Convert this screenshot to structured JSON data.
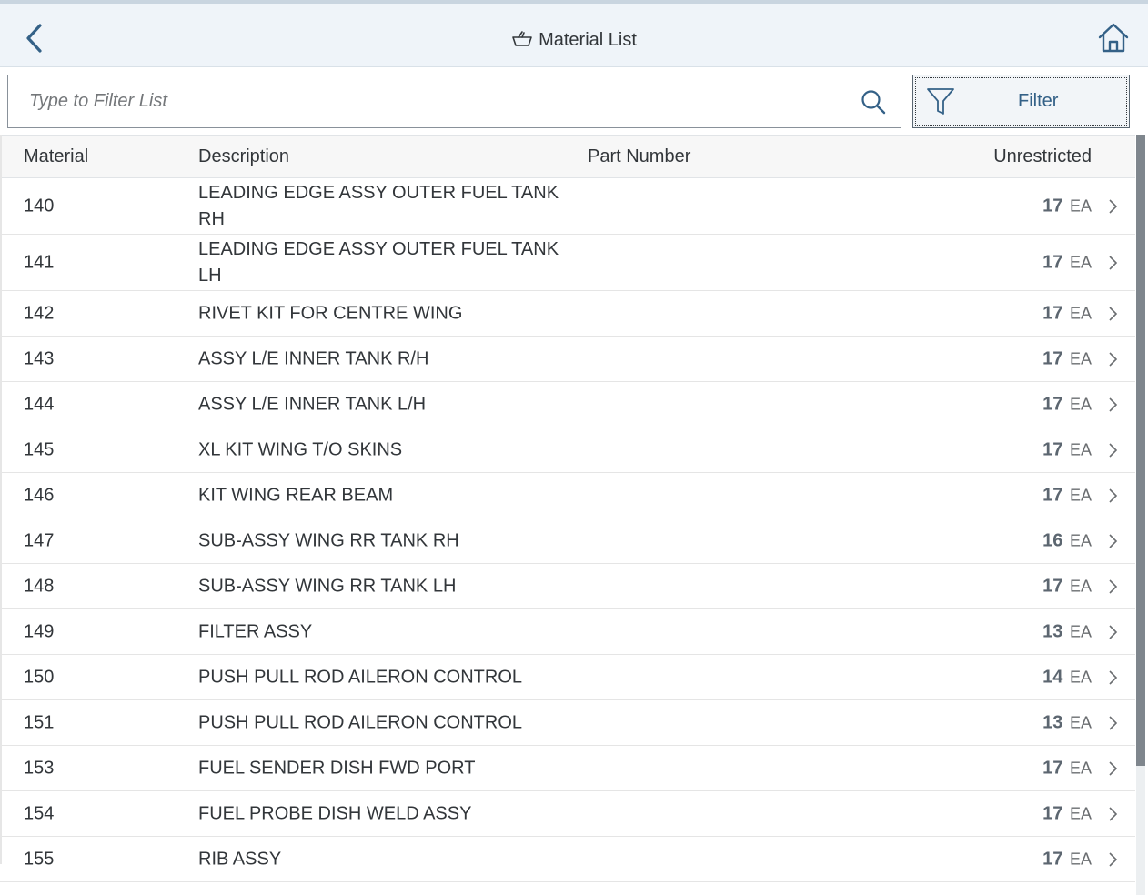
{
  "header": {
    "title": "Material List"
  },
  "search": {
    "placeholder": "Type to Filter List",
    "value": ""
  },
  "filter": {
    "label": "Filter"
  },
  "table": {
    "columns": {
      "material": "Material",
      "description": "Description",
      "part_number": "Part Number",
      "unrestricted": "Unrestricted"
    },
    "rows": [
      {
        "material": "140",
        "description": "LEADING EDGE ASSY OUTER FUEL TANK RH",
        "part_number": "",
        "qty": "17",
        "unit": "EA"
      },
      {
        "material": "141",
        "description": "LEADING EDGE ASSY OUTER FUEL TANK LH",
        "part_number": "",
        "qty": "17",
        "unit": "EA"
      },
      {
        "material": "142",
        "description": "RIVET KIT FOR CENTRE WING",
        "part_number": "",
        "qty": "17",
        "unit": "EA"
      },
      {
        "material": "143",
        "description": "ASSY L/E INNER TANK R/H",
        "part_number": "",
        "qty": "17",
        "unit": "EA"
      },
      {
        "material": "144",
        "description": "ASSY L/E INNER TANK L/H",
        "part_number": "",
        "qty": "17",
        "unit": "EA"
      },
      {
        "material": "145",
        "description": "XL KIT WING T/O SKINS",
        "part_number": "",
        "qty": "17",
        "unit": "EA"
      },
      {
        "material": "146",
        "description": "KIT WING REAR BEAM",
        "part_number": "",
        "qty": "17",
        "unit": "EA"
      },
      {
        "material": "147",
        "description": "SUB-ASSY WING RR TANK RH",
        "part_number": "",
        "qty": "16",
        "unit": "EA"
      },
      {
        "material": "148",
        "description": "SUB-ASSY WING RR TANK LH",
        "part_number": "",
        "qty": "17",
        "unit": "EA"
      },
      {
        "material": "149",
        "description": "FILTER ASSY",
        "part_number": "",
        "qty": "13",
        "unit": "EA"
      },
      {
        "material": "150",
        "description": "PUSH PULL ROD AILERON CONTROL",
        "part_number": "",
        "qty": "14",
        "unit": "EA"
      },
      {
        "material": "151",
        "description": "PUSH PULL ROD AILERON CONTROL",
        "part_number": "",
        "qty": "13",
        "unit": "EA"
      },
      {
        "material": "153",
        "description": "FUEL SENDER DISH FWD PORT",
        "part_number": "",
        "qty": "17",
        "unit": "EA"
      },
      {
        "material": "154",
        "description": "FUEL PROBE DISH WELD ASSY",
        "part_number": "",
        "qty": "17",
        "unit": "EA"
      },
      {
        "material": "155",
        "description": "RIB ASSY",
        "part_number": "",
        "qty": "17",
        "unit": "EA"
      }
    ]
  },
  "icons": {
    "back": "chevron-left-icon",
    "title": "basket-icon",
    "home": "home-icon",
    "search": "search-icon",
    "filter": "filter-icon",
    "row_nav": "chevron-right-icon"
  },
  "colors": {
    "header_bg": "#eff4f9",
    "accent": "#346187",
    "text": "#32363a"
  }
}
